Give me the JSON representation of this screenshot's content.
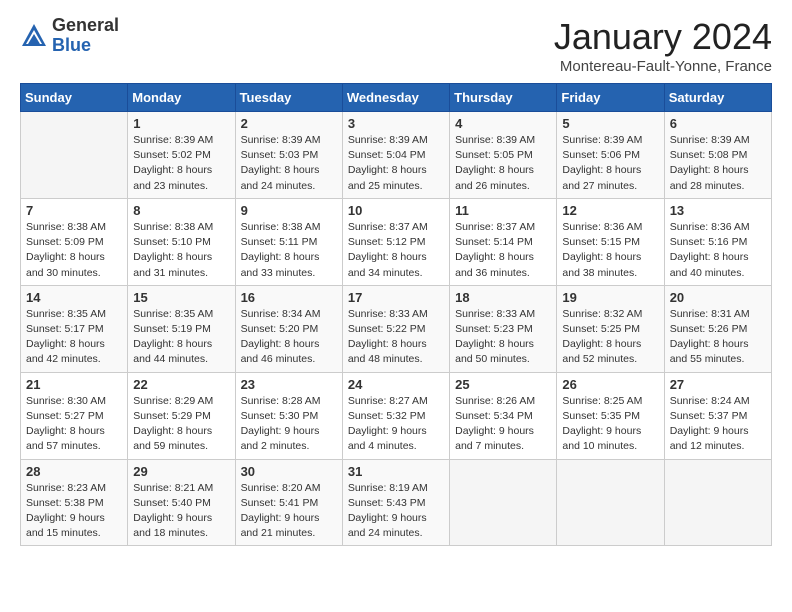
{
  "logo": {
    "general": "General",
    "blue": "Blue"
  },
  "header": {
    "title": "January 2024",
    "location": "Montereau-Fault-Yonne, France"
  },
  "weekdays": [
    "Sunday",
    "Monday",
    "Tuesday",
    "Wednesday",
    "Thursday",
    "Friday",
    "Saturday"
  ],
  "weeks": [
    [
      {
        "day": "",
        "sunrise": "",
        "sunset": "",
        "daylight": ""
      },
      {
        "day": "1",
        "sunrise": "Sunrise: 8:39 AM",
        "sunset": "Sunset: 5:02 PM",
        "daylight": "Daylight: 8 hours and 23 minutes."
      },
      {
        "day": "2",
        "sunrise": "Sunrise: 8:39 AM",
        "sunset": "Sunset: 5:03 PM",
        "daylight": "Daylight: 8 hours and 24 minutes."
      },
      {
        "day": "3",
        "sunrise": "Sunrise: 8:39 AM",
        "sunset": "Sunset: 5:04 PM",
        "daylight": "Daylight: 8 hours and 25 minutes."
      },
      {
        "day": "4",
        "sunrise": "Sunrise: 8:39 AM",
        "sunset": "Sunset: 5:05 PM",
        "daylight": "Daylight: 8 hours and 26 minutes."
      },
      {
        "day": "5",
        "sunrise": "Sunrise: 8:39 AM",
        "sunset": "Sunset: 5:06 PM",
        "daylight": "Daylight: 8 hours and 27 minutes."
      },
      {
        "day": "6",
        "sunrise": "Sunrise: 8:39 AM",
        "sunset": "Sunset: 5:08 PM",
        "daylight": "Daylight: 8 hours and 28 minutes."
      }
    ],
    [
      {
        "day": "7",
        "sunrise": "Sunrise: 8:38 AM",
        "sunset": "Sunset: 5:09 PM",
        "daylight": "Daylight: 8 hours and 30 minutes."
      },
      {
        "day": "8",
        "sunrise": "Sunrise: 8:38 AM",
        "sunset": "Sunset: 5:10 PM",
        "daylight": "Daylight: 8 hours and 31 minutes."
      },
      {
        "day": "9",
        "sunrise": "Sunrise: 8:38 AM",
        "sunset": "Sunset: 5:11 PM",
        "daylight": "Daylight: 8 hours and 33 minutes."
      },
      {
        "day": "10",
        "sunrise": "Sunrise: 8:37 AM",
        "sunset": "Sunset: 5:12 PM",
        "daylight": "Daylight: 8 hours and 34 minutes."
      },
      {
        "day": "11",
        "sunrise": "Sunrise: 8:37 AM",
        "sunset": "Sunset: 5:14 PM",
        "daylight": "Daylight: 8 hours and 36 minutes."
      },
      {
        "day": "12",
        "sunrise": "Sunrise: 8:36 AM",
        "sunset": "Sunset: 5:15 PM",
        "daylight": "Daylight: 8 hours and 38 minutes."
      },
      {
        "day": "13",
        "sunrise": "Sunrise: 8:36 AM",
        "sunset": "Sunset: 5:16 PM",
        "daylight": "Daylight: 8 hours and 40 minutes."
      }
    ],
    [
      {
        "day": "14",
        "sunrise": "Sunrise: 8:35 AM",
        "sunset": "Sunset: 5:17 PM",
        "daylight": "Daylight: 8 hours and 42 minutes."
      },
      {
        "day": "15",
        "sunrise": "Sunrise: 8:35 AM",
        "sunset": "Sunset: 5:19 PM",
        "daylight": "Daylight: 8 hours and 44 minutes."
      },
      {
        "day": "16",
        "sunrise": "Sunrise: 8:34 AM",
        "sunset": "Sunset: 5:20 PM",
        "daylight": "Daylight: 8 hours and 46 minutes."
      },
      {
        "day": "17",
        "sunrise": "Sunrise: 8:33 AM",
        "sunset": "Sunset: 5:22 PM",
        "daylight": "Daylight: 8 hours and 48 minutes."
      },
      {
        "day": "18",
        "sunrise": "Sunrise: 8:33 AM",
        "sunset": "Sunset: 5:23 PM",
        "daylight": "Daylight: 8 hours and 50 minutes."
      },
      {
        "day": "19",
        "sunrise": "Sunrise: 8:32 AM",
        "sunset": "Sunset: 5:25 PM",
        "daylight": "Daylight: 8 hours and 52 minutes."
      },
      {
        "day": "20",
        "sunrise": "Sunrise: 8:31 AM",
        "sunset": "Sunset: 5:26 PM",
        "daylight": "Daylight: 8 hours and 55 minutes."
      }
    ],
    [
      {
        "day": "21",
        "sunrise": "Sunrise: 8:30 AM",
        "sunset": "Sunset: 5:27 PM",
        "daylight": "Daylight: 8 hours and 57 minutes."
      },
      {
        "day": "22",
        "sunrise": "Sunrise: 8:29 AM",
        "sunset": "Sunset: 5:29 PM",
        "daylight": "Daylight: 8 hours and 59 minutes."
      },
      {
        "day": "23",
        "sunrise": "Sunrise: 8:28 AM",
        "sunset": "Sunset: 5:30 PM",
        "daylight": "Daylight: 9 hours and 2 minutes."
      },
      {
        "day": "24",
        "sunrise": "Sunrise: 8:27 AM",
        "sunset": "Sunset: 5:32 PM",
        "daylight": "Daylight: 9 hours and 4 minutes."
      },
      {
        "day": "25",
        "sunrise": "Sunrise: 8:26 AM",
        "sunset": "Sunset: 5:34 PM",
        "daylight": "Daylight: 9 hours and 7 minutes."
      },
      {
        "day": "26",
        "sunrise": "Sunrise: 8:25 AM",
        "sunset": "Sunset: 5:35 PM",
        "daylight": "Daylight: 9 hours and 10 minutes."
      },
      {
        "day": "27",
        "sunrise": "Sunrise: 8:24 AM",
        "sunset": "Sunset: 5:37 PM",
        "daylight": "Daylight: 9 hours and 12 minutes."
      }
    ],
    [
      {
        "day": "28",
        "sunrise": "Sunrise: 8:23 AM",
        "sunset": "Sunset: 5:38 PM",
        "daylight": "Daylight: 9 hours and 15 minutes."
      },
      {
        "day": "29",
        "sunrise": "Sunrise: 8:21 AM",
        "sunset": "Sunset: 5:40 PM",
        "daylight": "Daylight: 9 hours and 18 minutes."
      },
      {
        "day": "30",
        "sunrise": "Sunrise: 8:20 AM",
        "sunset": "Sunset: 5:41 PM",
        "daylight": "Daylight: 9 hours and 21 minutes."
      },
      {
        "day": "31",
        "sunrise": "Sunrise: 8:19 AM",
        "sunset": "Sunset: 5:43 PM",
        "daylight": "Daylight: 9 hours and 24 minutes."
      },
      {
        "day": "",
        "sunrise": "",
        "sunset": "",
        "daylight": ""
      },
      {
        "day": "",
        "sunrise": "",
        "sunset": "",
        "daylight": ""
      },
      {
        "day": "",
        "sunrise": "",
        "sunset": "",
        "daylight": ""
      }
    ]
  ]
}
